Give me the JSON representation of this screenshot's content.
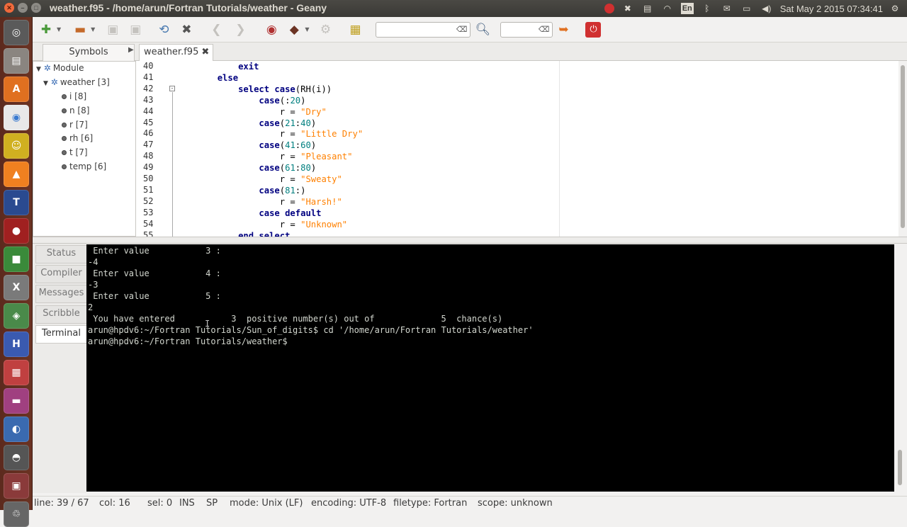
{
  "window": {
    "title": "weather.f95 - /home/arun/Fortran Tutorials/weather - Geany"
  },
  "tray": {
    "language": "En",
    "clock": "Sat May  2 2015 07:34:41"
  },
  "launcher_icons": [
    "ubuntu-dash-icon",
    "files-icon",
    "software-center-icon",
    "chrome-icon",
    "geany-icon",
    "vlc-icon",
    "texmaker-icon",
    "ubuntu-one-icon",
    "libreoffice-icon",
    "xfig-icon",
    "virtualbox-icon",
    "hdf-icon",
    "calculator-icon",
    "impress-icon",
    "updater-icon",
    "disk-icon",
    "tools-icon",
    "trash-icon"
  ],
  "toolbar": {
    "search_placeholder": "",
    "goto_placeholder": ""
  },
  "tabs": {
    "sidebar_tab": "Symbols",
    "editor_tab": "weather.f95"
  },
  "symbols": {
    "module": "Module",
    "weather": "weather [3]",
    "items": [
      "i [8]",
      "n [8]",
      "r [7]",
      "rh [6]",
      "t [7]",
      "temp [6]"
    ]
  },
  "code": {
    "line_numbers": [
      "40",
      "41",
      "42",
      "43",
      "44",
      "45",
      "46",
      "47",
      "48",
      "49",
      "50",
      "51",
      "52",
      "53",
      "54",
      "55"
    ],
    "lines": [
      [
        {
          "t": "            ",
          "c": "pl"
        },
        {
          "t": "exit",
          "c": "kw"
        }
      ],
      [
        {
          "t": "        ",
          "c": "pl"
        },
        {
          "t": "else",
          "c": "kw"
        }
      ],
      [
        {
          "t": "            ",
          "c": "pl"
        },
        {
          "t": "select case",
          "c": "kw"
        },
        {
          "t": "(RH(i))",
          "c": "pl"
        }
      ],
      [
        {
          "t": "                ",
          "c": "pl"
        },
        {
          "t": "case",
          "c": "kw"
        },
        {
          "t": "(:",
          "c": "pl"
        },
        {
          "t": "20",
          "c": "num"
        },
        {
          "t": ")",
          "c": "pl"
        }
      ],
      [
        {
          "t": "                    r = ",
          "c": "pl"
        },
        {
          "t": "\"Dry\"",
          "c": "str"
        }
      ],
      [
        {
          "t": "                ",
          "c": "pl"
        },
        {
          "t": "case",
          "c": "kw"
        },
        {
          "t": "(",
          "c": "pl"
        },
        {
          "t": "21",
          "c": "num"
        },
        {
          "t": ":",
          "c": "pl"
        },
        {
          "t": "40",
          "c": "num"
        },
        {
          "t": ")",
          "c": "pl"
        }
      ],
      [
        {
          "t": "                    r = ",
          "c": "pl"
        },
        {
          "t": "\"Little Dry\"",
          "c": "str"
        }
      ],
      [
        {
          "t": "                ",
          "c": "pl"
        },
        {
          "t": "case",
          "c": "kw"
        },
        {
          "t": "(",
          "c": "pl"
        },
        {
          "t": "41",
          "c": "num"
        },
        {
          "t": ":",
          "c": "pl"
        },
        {
          "t": "60",
          "c": "num"
        },
        {
          "t": ")",
          "c": "pl"
        }
      ],
      [
        {
          "t": "                    r = ",
          "c": "pl"
        },
        {
          "t": "\"Pleasant\"",
          "c": "str"
        }
      ],
      [
        {
          "t": "                ",
          "c": "pl"
        },
        {
          "t": "case",
          "c": "kw"
        },
        {
          "t": "(",
          "c": "pl"
        },
        {
          "t": "61",
          "c": "num"
        },
        {
          "t": ":",
          "c": "pl"
        },
        {
          "t": "80",
          "c": "num"
        },
        {
          "t": ")",
          "c": "pl"
        }
      ],
      [
        {
          "t": "                    r = ",
          "c": "pl"
        },
        {
          "t": "\"Sweaty\"",
          "c": "str"
        }
      ],
      [
        {
          "t": "                ",
          "c": "pl"
        },
        {
          "t": "case",
          "c": "kw"
        },
        {
          "t": "(",
          "c": "pl"
        },
        {
          "t": "81",
          "c": "num"
        },
        {
          "t": ":)",
          "c": "pl"
        }
      ],
      [
        {
          "t": "                    r = ",
          "c": "pl"
        },
        {
          "t": "\"Harsh!\"",
          "c": "str"
        }
      ],
      [
        {
          "t": "                ",
          "c": "pl"
        },
        {
          "t": "case default",
          "c": "kw"
        }
      ],
      [
        {
          "t": "                    r = ",
          "c": "pl"
        },
        {
          "t": "\"Unknown\"",
          "c": "str"
        }
      ],
      [
        {
          "t": "            ",
          "c": "pl"
        },
        {
          "t": "end select",
          "c": "kw"
        }
      ]
    ]
  },
  "bottom_tabs": [
    "Status",
    "Compiler",
    "Messages",
    "Scribble",
    "Terminal"
  ],
  "terminal_lines": [
    " Enter value           3 :",
    "-4",
    " Enter value           4 :",
    "-3",
    " Enter value           5 :",
    "2",
    " You have entered           3  positive number(s) out of             5  chance(s)",
    "arun@hpdv6:~/Fortran Tutorials/Sun_of_digits$ cd '/home/arun/Fortran Tutorials/weather'",
    "arun@hpdv6:~/Fortran Tutorials/weather$ "
  ],
  "status": {
    "line": "line: 39 / 67",
    "col": "col: 16",
    "sel": "sel: 0",
    "ins": "INS",
    "sp": "SP",
    "mode": "mode: Unix (LF)",
    "encoding": "encoding: UTF-8",
    "filetype": "filetype: Fortran",
    "scope": "scope: unknown"
  },
  "colors": {
    "keyword": "#000080",
    "number": "#007f7f",
    "string": "#ff8000",
    "launcher_bg": "#5c2a1e"
  }
}
